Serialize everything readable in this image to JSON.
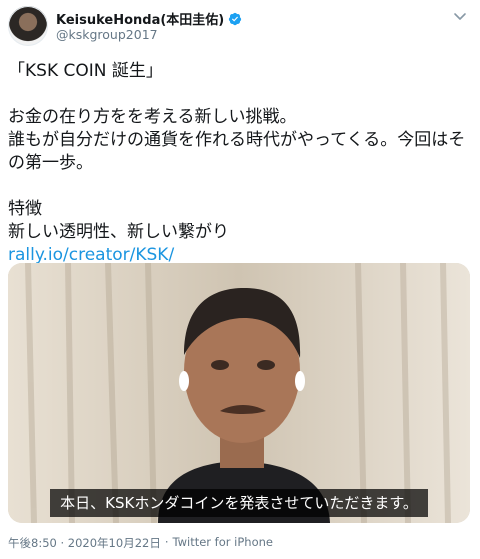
{
  "author": {
    "display_name": "KeisukeHonda(本田圭佑)",
    "handle": "@kskgroup2017"
  },
  "tweet": {
    "line1": "「KSK COIN 誕生」",
    "line2": "お金の在り方をを考える新しい挑戦。\n誰もが自分だけの通貨を作れる時代がやってくる。今回はその第一歩。",
    "line3": "特徴\n新しい透明性、新しい繋がり",
    "link": "rally.io/creator/KSK/"
  },
  "media": {
    "caption": "本日、KSKホンダコインを発表させていただきます。"
  },
  "meta": {
    "timestamp": "午後8:50 · 2020年10月22日",
    "separator": "·",
    "source": "Twitter for iPhone"
  },
  "colors": {
    "verified_blue": "#1da1f2",
    "link_blue": "#1b95e0",
    "secondary_text": "#657786"
  }
}
